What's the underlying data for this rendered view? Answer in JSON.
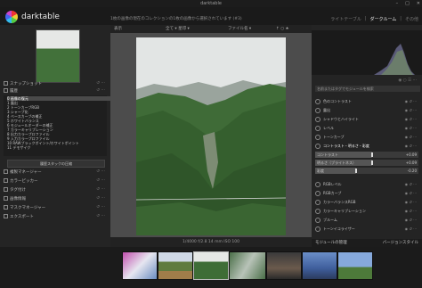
{
  "window": {
    "title": "darktable",
    "controls": [
      "–",
      "□",
      "✕"
    ]
  },
  "header": {
    "app_name": "darktable",
    "headline": "1枚の画像の現在のコレクションの1枚の画像から選択されています (#3)",
    "views": [
      {
        "label": "ライトテーブル",
        "active": false
      },
      {
        "label": "|",
        "active": false
      },
      {
        "label": "ダークルーム",
        "active": true
      },
      {
        "label": "|",
        "active": false
      },
      {
        "label": "その他",
        "active": false
      }
    ]
  },
  "center_toolbar": {
    "left_label": "表示",
    "filter_label": "全て ▾ 星印 ▾",
    "sort_label": "ファイル名 ▾",
    "sort_icons": "↑ ○ ★"
  },
  "exif_line": "1/4000 f/2.8 14 mm ISO 100",
  "left_panel": {
    "snapshots": {
      "label": "スナップショット"
    },
    "history": {
      "label": "履歴"
    },
    "history_items": [
      "0 画像の復元",
      "1 露出",
      "2 トーンカーブRGB",
      "3 シャープ化",
      "4 ベースカーブの補正",
      "5 ホワイトバランス",
      "6 モジュールオーダーの補正",
      "7 カラーキャリブレーション",
      "8 出力カラープロファイル",
      "9 入力カラープロファイル",
      "10 RAWブラックポイント/ホワイトポイント",
      "11 デモザイク"
    ],
    "compress_button": "履歴スタックの圧縮",
    "modules": [
      "複製マネージャー",
      "カラーピッカー",
      "タグ付け",
      "画像情報",
      "マスクマネージャー",
      "エクスポート"
    ]
  },
  "right_panel": {
    "search_placeholder": "名前またはタグでモジュールを検索",
    "modules": [
      {
        "label": "色のコントラスト",
        "expanded": false
      },
      {
        "label": "露出",
        "expanded": false
      },
      {
        "label": "シャドウとハイライト",
        "expanded": false
      },
      {
        "label": "レベル",
        "expanded": false
      },
      {
        "label": "トーンカーブ",
        "expanded": false
      },
      {
        "label": "コントラスト・明るさ・彩度",
        "expanded": true
      }
    ],
    "sliders": [
      {
        "label": "コントラスト",
        "value_text": "+0.09",
        "value": 0.55
      },
      {
        "label": "明るさ（ブライトネス）",
        "value_text": "+0.09",
        "value": 0.55
      },
      {
        "label": "彩度",
        "value_text": "-0.20",
        "value": 0.4
      }
    ],
    "modules2": [
      {
        "label": "RGBレベル"
      },
      {
        "label": "RGBカーブ"
      },
      {
        "label": "カラーバランスRGB"
      },
      {
        "label": "カラーキャリブレーション"
      },
      {
        "label": "ブルーム"
      },
      {
        "label": "トーンイコライザー"
      }
    ],
    "bottom_left": "モジュールの管理",
    "bottom_right": "バージョンスタイル"
  },
  "colors": {
    "panel_bg": "#242424",
    "center_bg": "#4c4c4c",
    "selected_row": "#4a4a4a"
  }
}
